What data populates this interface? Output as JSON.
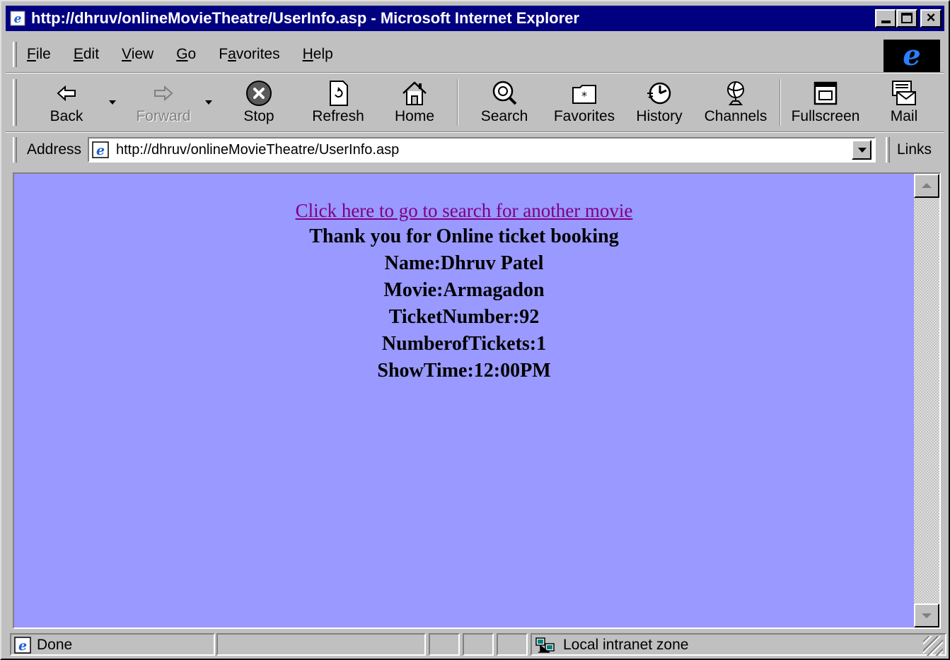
{
  "window": {
    "title": "http://dhruv/onlineMovieTheatre/UserInfo.asp - Microsoft Internet Explorer"
  },
  "menu": {
    "items": [
      {
        "key": "F",
        "rest": "ile"
      },
      {
        "key": "E",
        "rest": "dit"
      },
      {
        "key": "V",
        "rest": "iew"
      },
      {
        "key": "G",
        "rest": "o"
      },
      {
        "pre": "F",
        "key": "a",
        "rest": "vorites"
      },
      {
        "key": "H",
        "rest": "elp"
      }
    ]
  },
  "toolbar": {
    "back": "Back",
    "forward": "Forward",
    "stop": "Stop",
    "refresh": "Refresh",
    "home": "Home",
    "search": "Search",
    "favorites": "Favorites",
    "history": "History",
    "channels": "Channels",
    "fullscreen": "Fullscreen",
    "mail": "Mail"
  },
  "address": {
    "label": "Address",
    "url": "http://dhruv/onlineMovieTheatre/UserInfo.asp",
    "links": "Links"
  },
  "page": {
    "link_text": "Click here to go to search for another movie",
    "lines": [
      "Thank you for Online ticket booking",
      "Name:Dhruv Patel",
      "Movie:Armagadon",
      "TicketNumber:92",
      "NumberofTickets:1",
      "ShowTime:12:00PM"
    ],
    "background": "#9999ff",
    "link_color": "#800080"
  },
  "status": {
    "text": "Done",
    "zone": "Local intranet zone"
  }
}
